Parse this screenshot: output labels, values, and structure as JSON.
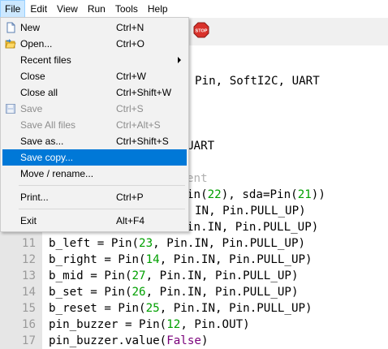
{
  "menubar": {
    "items": [
      "File",
      "Edit",
      "View",
      "Run",
      "Tools",
      "Help"
    ]
  },
  "toolbar": {
    "stop_icon": "stop-icon",
    "stop_text": "STOP"
  },
  "editor": {
    "lines": [
      {
        "n": "",
        "segs": [
          {
            "t": "Pin, SoftI2C, UART",
            "c": ""
          }
        ]
      },
      {
        "n": "",
        "segs": [
          {
            "t": "UART",
            "c": ""
          }
        ]
      },
      {
        "n": "",
        "segs": [
          {
            "t": "ent",
            "c": "cmt"
          }
        ]
      },
      {
        "n": "",
        "segs": [
          {
            "t": "in(",
            "c": ""
          },
          {
            "t": "22",
            "c": "num"
          },
          {
            "t": "), sda=Pin(",
            "c": ""
          },
          {
            "t": "21",
            "c": "num"
          },
          {
            "t": "))",
            "c": ""
          }
        ]
      },
      {
        "n": "",
        "segs": [
          {
            "t": "IN, Pin.PULL_UP)",
            "c": ""
          }
        ]
      },
      {
        "n": "",
        "segs": [
          {
            "t": "in.IN, Pin.PULL_UP)",
            "c": ""
          }
        ]
      },
      {
        "n": "11",
        "segs": [
          {
            "t": "b_left = Pin(",
            "c": ""
          },
          {
            "t": "23",
            "c": "num"
          },
          {
            "t": ", Pin.IN, Pin.PULL_UP)",
            "c": ""
          }
        ]
      },
      {
        "n": "12",
        "segs": [
          {
            "t": "b_right = Pin(",
            "c": ""
          },
          {
            "t": "14",
            "c": "num"
          },
          {
            "t": ", Pin.IN, Pin.PULL_UP)",
            "c": ""
          }
        ]
      },
      {
        "n": "13",
        "segs": [
          {
            "t": "b_mid = Pin(",
            "c": ""
          },
          {
            "t": "27",
            "c": "num"
          },
          {
            "t": ", Pin.IN, Pin.PULL_UP)",
            "c": ""
          }
        ]
      },
      {
        "n": "14",
        "segs": [
          {
            "t": "b_set = Pin(",
            "c": ""
          },
          {
            "t": "26",
            "c": "num"
          },
          {
            "t": ", Pin.IN, Pin.PULL_UP)",
            "c": ""
          }
        ]
      },
      {
        "n": "15",
        "segs": [
          {
            "t": "b_reset = Pin(",
            "c": ""
          },
          {
            "t": "25",
            "c": "num"
          },
          {
            "t": ", Pin.IN, Pin.PULL_UP)",
            "c": ""
          }
        ]
      },
      {
        "n": "16",
        "segs": [
          {
            "t": "pin_buzzer = Pin(",
            "c": ""
          },
          {
            "t": "12",
            "c": "num"
          },
          {
            "t": ", Pin.OUT)",
            "c": ""
          }
        ]
      },
      {
        "n": "17",
        "segs": [
          {
            "t": "pin_buzzer.value(",
            "c": ""
          },
          {
            "t": "False",
            "c": "kw"
          },
          {
            "t": ")",
            "c": ""
          }
        ]
      }
    ]
  },
  "file_menu": {
    "items": [
      {
        "label": "New",
        "shortcut": "Ctrl+N",
        "icon": "new-file-icon"
      },
      {
        "label": "Open...",
        "shortcut": "Ctrl+O",
        "icon": "open-folder-icon"
      },
      {
        "label": "Recent files",
        "shortcut": "",
        "submenu": true
      },
      {
        "label": "Close",
        "shortcut": "Ctrl+W"
      },
      {
        "label": "Close all",
        "shortcut": "Ctrl+Shift+W"
      },
      {
        "label": "Save",
        "shortcut": "Ctrl+S",
        "disabled": true,
        "icon": "save-icon"
      },
      {
        "label": "Save All files",
        "shortcut": "Ctrl+Alt+S",
        "disabled": true
      },
      {
        "label": "Save as...",
        "shortcut": "Ctrl+Shift+S"
      },
      {
        "label": "Save copy...",
        "shortcut": "",
        "highlighted": true
      },
      {
        "label": "Move / rename...",
        "shortcut": ""
      },
      {
        "label": "Print...",
        "shortcut": "Ctrl+P"
      },
      {
        "label": "Exit",
        "shortcut": "Alt+F4"
      }
    ]
  },
  "colors": {
    "highlight": "#0078d7",
    "menu_bg": "#f2f2f2",
    "active_menu": "#cce8ff",
    "number": "#00a000",
    "keyword": "#7a007a",
    "comment": "#b0b0b0"
  }
}
